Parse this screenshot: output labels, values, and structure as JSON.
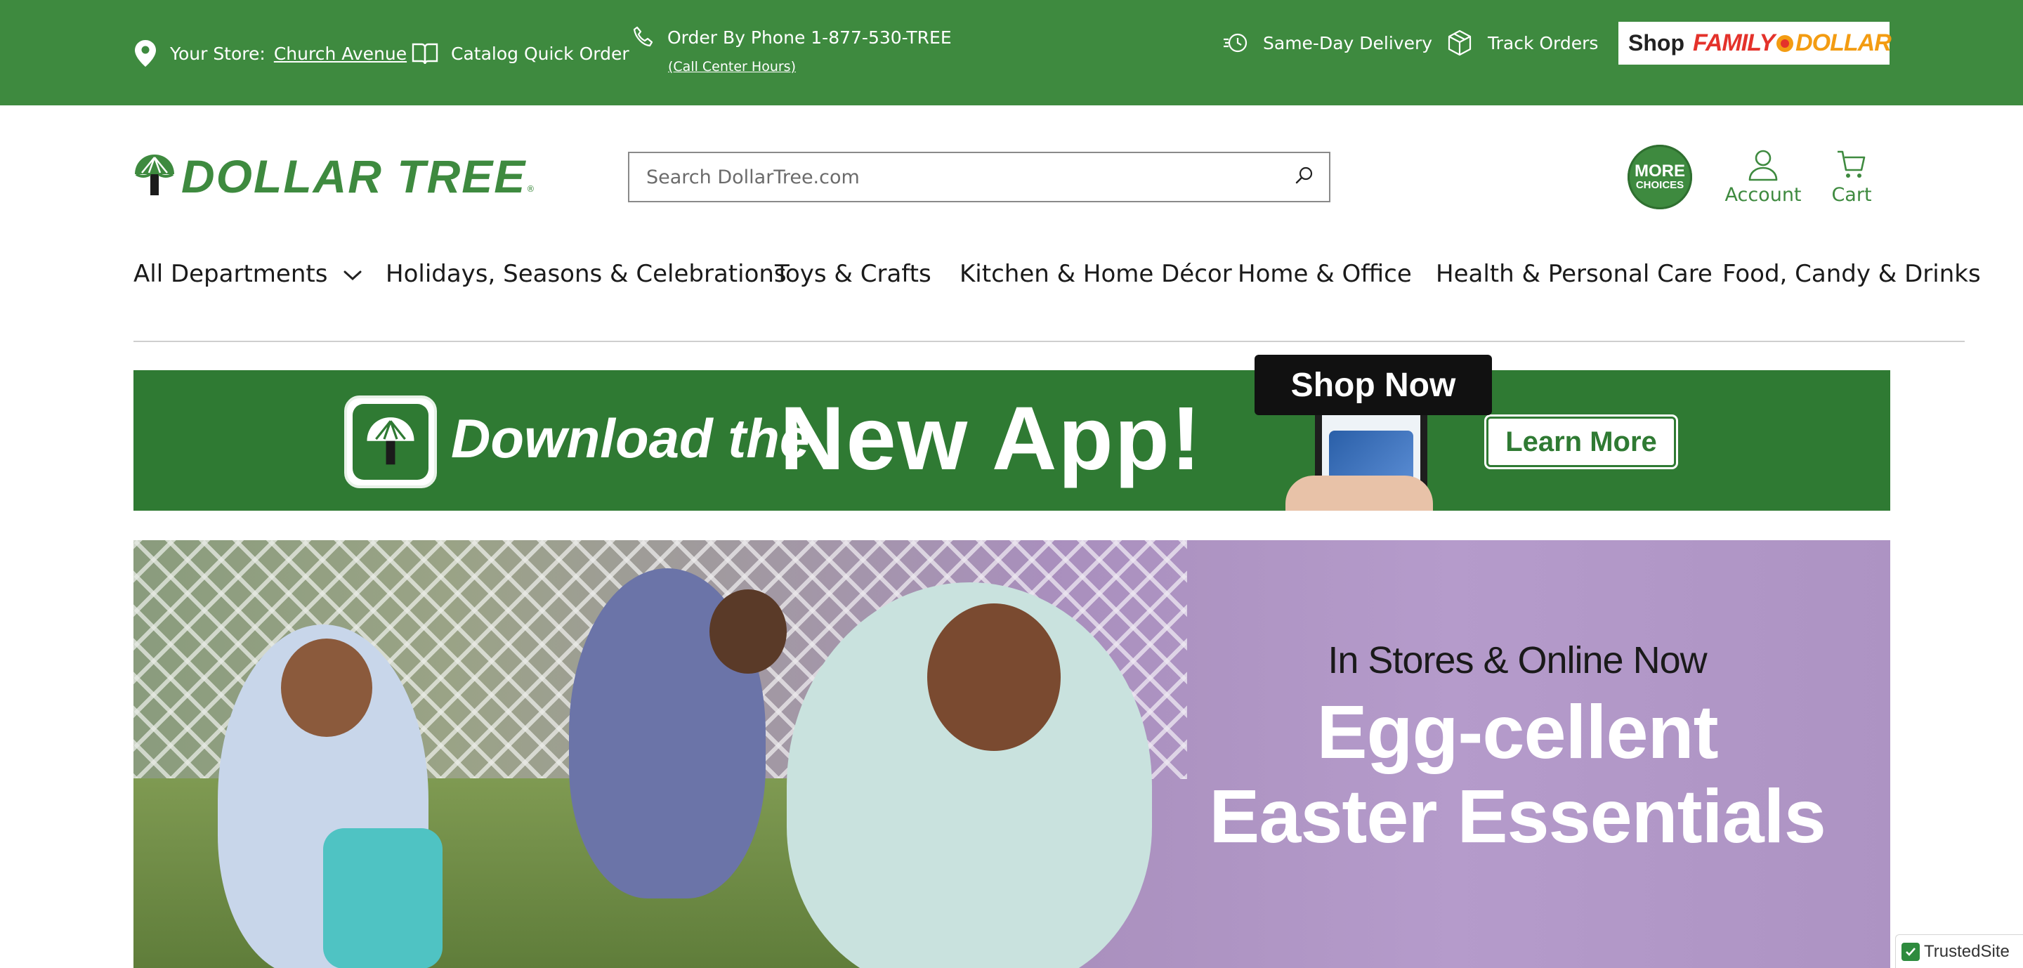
{
  "topbar": {
    "store_label": "Your Store:",
    "store_name": "Church Avenue",
    "catalog": "Catalog Quick Order",
    "phone": "Order By Phone 1-877-530-TREE",
    "call_center_hours": "(Call Center Hours)",
    "delivery": "Same-Day Delivery",
    "track_orders": "Track Orders",
    "shop_label": "Shop",
    "family_dollar": {
      "family": "FAMILY",
      "dollar": "DOLLAR"
    }
  },
  "header": {
    "logo_text": "DOLLAR TREE",
    "logo_mark": "®",
    "search_placeholder": "Search DollarTree.com",
    "more_choices": {
      "line1": "MORE",
      "line2": "CHOICES"
    },
    "account": "Account",
    "cart": "Cart"
  },
  "nav": {
    "items": [
      "All Departments",
      "Holidays, Seasons & Celebrations",
      "Toys & Crafts",
      "Kitchen & Home Décor",
      "Home & Office",
      "Health & Personal Care",
      "Food, Candy & Drinks"
    ]
  },
  "app_banner": {
    "text1": "Download the",
    "text2": "New App!",
    "cta": "Learn More"
  },
  "hero": {
    "subtitle": "In Stores & Online Now",
    "title_line1": "Egg-cellent",
    "title_line2": "Easter Essentials",
    "cta": "Shop Now"
  },
  "badge": {
    "label": "TrustedSite"
  },
  "colors": {
    "brand_green": "#3e8a3f",
    "banner_green": "#2f7a33",
    "hero_purple": "#b59bcb",
    "family_dollar_red": "#e4322b",
    "family_dollar_orange": "#f39c12"
  },
  "icons": [
    "location-pin-icon",
    "catalog-book-icon",
    "phone-icon",
    "delivery-clock-icon",
    "package-icon",
    "search-icon",
    "account-icon",
    "cart-icon",
    "chevron-down-icon",
    "checkmark-icon"
  ]
}
